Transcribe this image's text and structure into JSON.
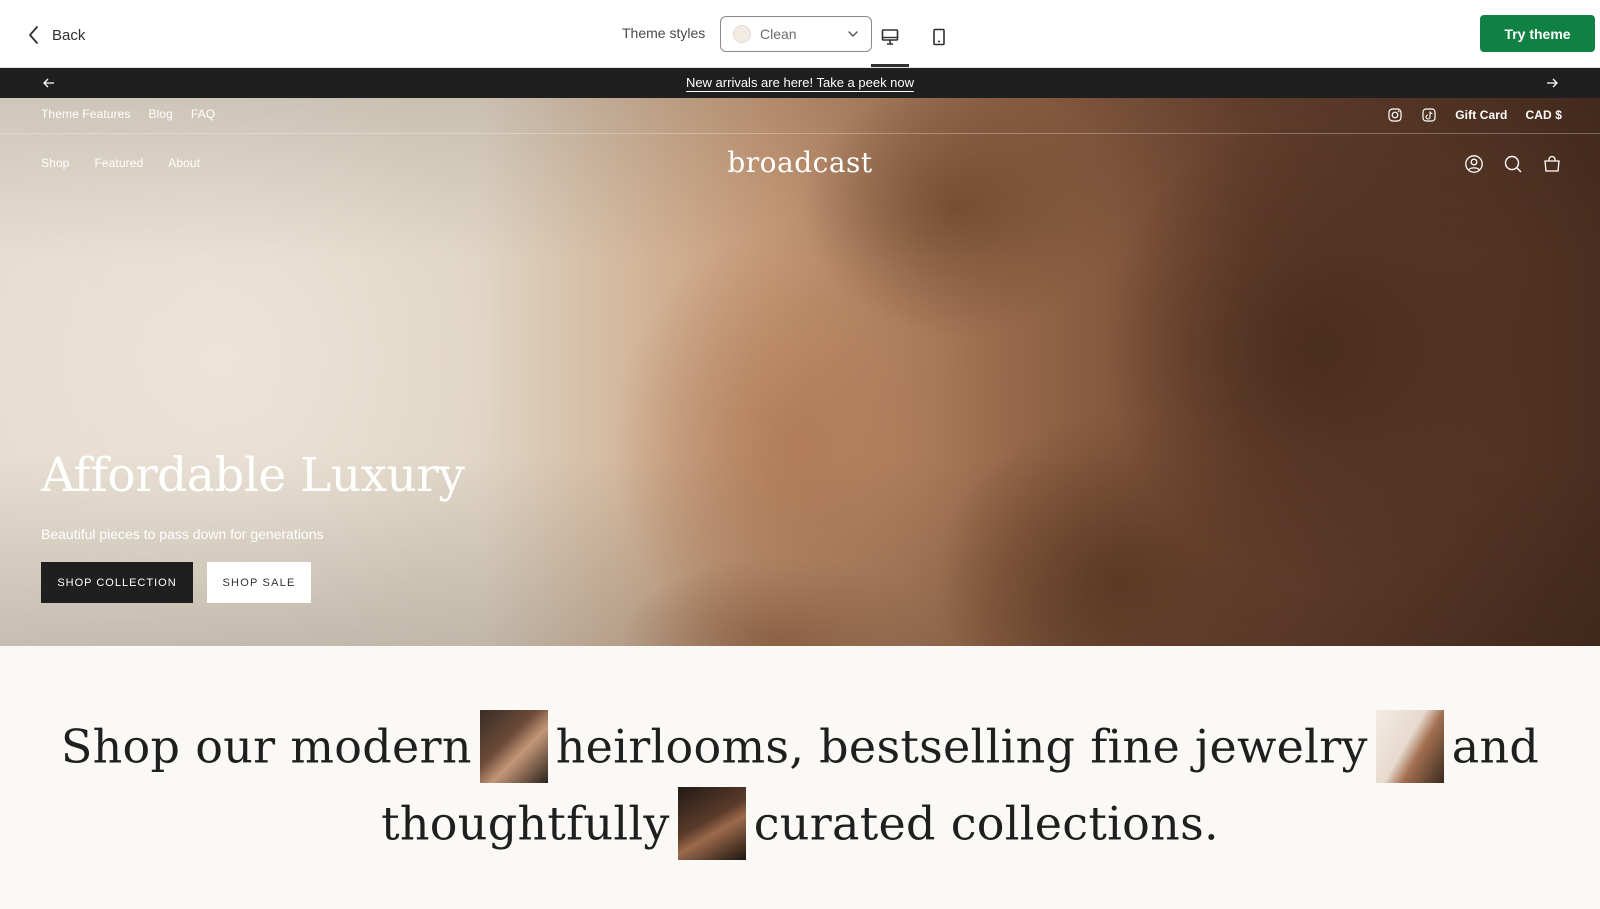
{
  "toolbar": {
    "back_label": "Back",
    "theme_styles_label": "Theme styles",
    "style_select_value": "Clean",
    "style_swatch_color": "#f1ebe3",
    "try_theme_label": "Try theme",
    "try_theme_color": "#108043",
    "view_modes": [
      "desktop-icon",
      "mobile-icon"
    ],
    "active_view": "desktop"
  },
  "announcement": {
    "text": "New arrivals are here! Take a peek now",
    "background": "#1f1f1f"
  },
  "utility_nav": {
    "links": [
      "Theme Features",
      "Blog",
      "FAQ"
    ],
    "social_icons": [
      "instagram-icon",
      "tiktok-icon"
    ],
    "gift_card": "Gift Card",
    "currency": "CAD $"
  },
  "header": {
    "nav": [
      "Shop",
      "Featured",
      "About"
    ],
    "logo": "broadcast",
    "icons": [
      "account-icon",
      "search-icon",
      "cart-icon"
    ]
  },
  "hero": {
    "title": "Affordable Luxury",
    "subtitle": "Beautiful pieces to pass down for generations",
    "primary_button": "SHOP COLLECTION",
    "secondary_button": "SHOP SALE"
  },
  "intro": {
    "part1": "Shop our modern",
    "part2": "heirlooms, bestselling fine jewelry",
    "part3": "and",
    "part4": "thoughtfully",
    "part5": "curated collections."
  }
}
